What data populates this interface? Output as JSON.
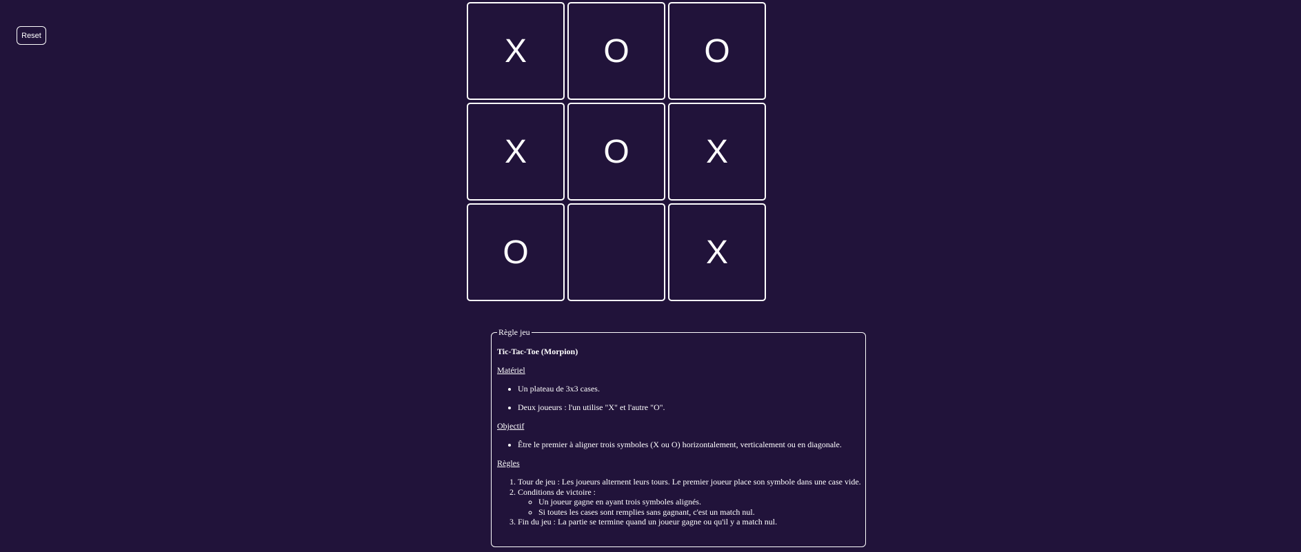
{
  "toolbar": {
    "reset_label": "Reset"
  },
  "board": {
    "cells": [
      "X",
      "O",
      "O",
      "X",
      "O",
      "X",
      "O",
      "",
      "X"
    ]
  },
  "rules": {
    "legend": "Règle jeu",
    "title": "Tic-Tac-Toe (Morpion)",
    "materiel": {
      "heading": "Matériel",
      "items": [
        "Un plateau de 3x3 cases.",
        "Deux joueurs : l'un utilise \"X\" et l'autre \"O\"."
      ]
    },
    "objectif": {
      "heading": "Objectif",
      "items": [
        "Être le premier à aligner trois symboles (X ou O) horizontalement, verticalement ou en diagonale."
      ]
    },
    "regles": {
      "heading": "Règles",
      "steps": [
        "Tour de jeu : Les joueurs alternent leurs tours. Le premier joueur place son symbole dans une case vide.",
        "Conditions de victoire :",
        "Fin du jeu : La partie se termine quand un joueur gagne ou qu'il y a match nul."
      ],
      "victory_conditions": [
        "Un joueur gagne en ayant trois symboles alignés.",
        "Si toutes les cases sont remplies sans gagnant, c'est un match nul."
      ]
    }
  },
  "colors": {
    "background": "#21133a",
    "foreground": "#ffffff"
  }
}
